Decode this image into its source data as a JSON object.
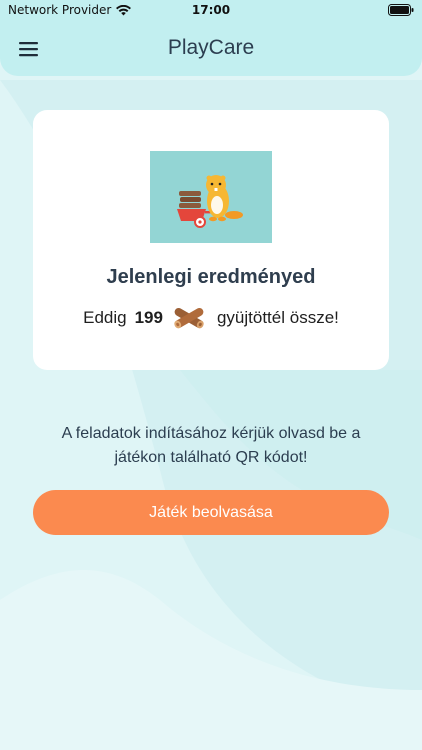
{
  "status_bar": {
    "carrier": "Network Provider",
    "time": "17:00"
  },
  "header": {
    "title": "PlayCare",
    "menu_icon": "hamburger-menu-icon"
  },
  "score_card": {
    "image": "beaver-with-wheelbarrow-illustration",
    "title": "Jelenlegi eredményed",
    "prefix": "Eddig",
    "count": "199",
    "suffix": "gyüjtöttél össze!",
    "item_icon": "logs-icon"
  },
  "instruction": {
    "text": "A feladatok indításához kérjük olvasd be a játékon található QR kódot!"
  },
  "scan_button": {
    "label": "Játék beolvasása"
  },
  "colors": {
    "background": "#d9f4f5",
    "header": "#c2eff0",
    "accent": "#fb8a4f",
    "card": "#ffffff",
    "image_bg": "#93d5d4"
  }
}
